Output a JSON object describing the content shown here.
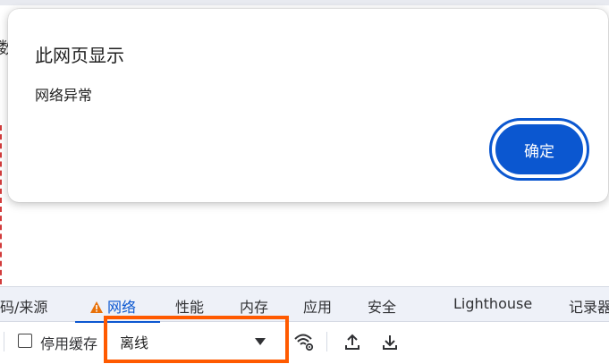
{
  "page": {
    "fragment": "数"
  },
  "dialog": {
    "title": "此网页显示",
    "message": "网络异常",
    "ok_label": "确定"
  },
  "devtools": {
    "tabs": [
      {
        "label": "码/来源"
      },
      {
        "label": "网络",
        "active": true,
        "icon": "warning-icon"
      },
      {
        "label": "性能"
      },
      {
        "label": "内存"
      },
      {
        "label": "应用"
      },
      {
        "label": "安全"
      },
      {
        "label": "Lighthouse"
      },
      {
        "label": "记录器"
      }
    ],
    "toolbar": {
      "disable_cache_label": "停用缓存",
      "throttle_value": "离线",
      "icons": [
        "network-conditions-icon",
        "import-har-icon",
        "export-har-icon"
      ]
    }
  },
  "colors": {
    "accent": "#0b57d0",
    "warning": "#e8710a",
    "highlight": "#ff5a00"
  }
}
